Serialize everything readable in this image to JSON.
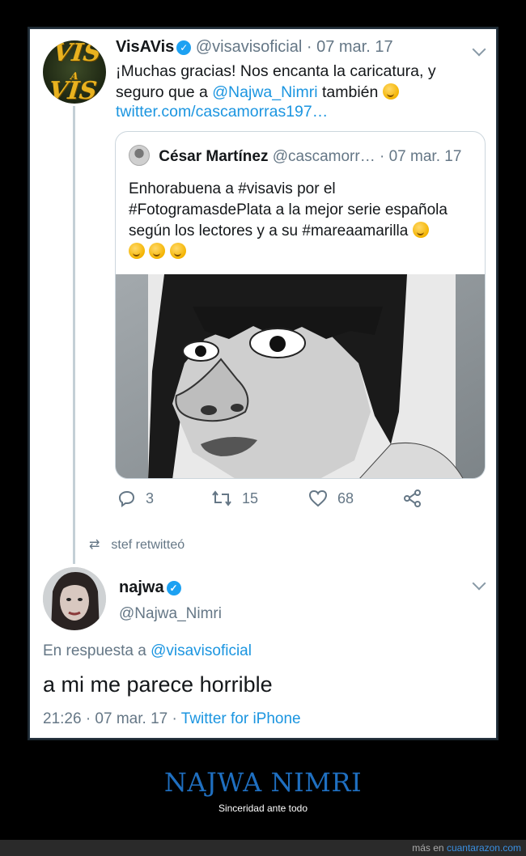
{
  "tweet1": {
    "name": "VisAVis",
    "handle": "@visavisoficial",
    "date": "· 07 mar. 17",
    "text_a": "¡Muchas gracias! Nos encanta la caricatura, y seguro que a",
    "mention": "@Najwa_Nimri",
    "text_b": "también",
    "link": "twitter.com/cascamorras197…",
    "logo_text": "VIS A VIS"
  },
  "quote": {
    "name": "César Martínez",
    "handle": "@cascamorr…",
    "date": "· 07 mar. 17",
    "text": "Enhorabuena a #visavis por el #FotogramasdePlata a la mejor serie española según los lectores y a su #mareaamarilla"
  },
  "actions": {
    "replies": "3",
    "retweets": "15",
    "likes": "68"
  },
  "retweeted_by": "stef retwitteó",
  "tweet2": {
    "name": "najwa",
    "handle": "@Najwa_Nimri",
    "reply_prefix": "En respuesta a",
    "reply_to": "@visavisoficial",
    "text": "a mi me parece horrible",
    "time": "21:26 · 07 mar. 17 ·",
    "source": "Twitter for iPhone"
  },
  "footer": {
    "title": "NAJWA NIMRI",
    "subtitle": "Sinceridad ante todo",
    "credit_prefix": "más en",
    "credit_site": "cuantarazon.com"
  },
  "colors": {
    "link_blue": "#1b95e0",
    "title_blue": "#1f6fc0",
    "verified": "#1da1f2"
  }
}
